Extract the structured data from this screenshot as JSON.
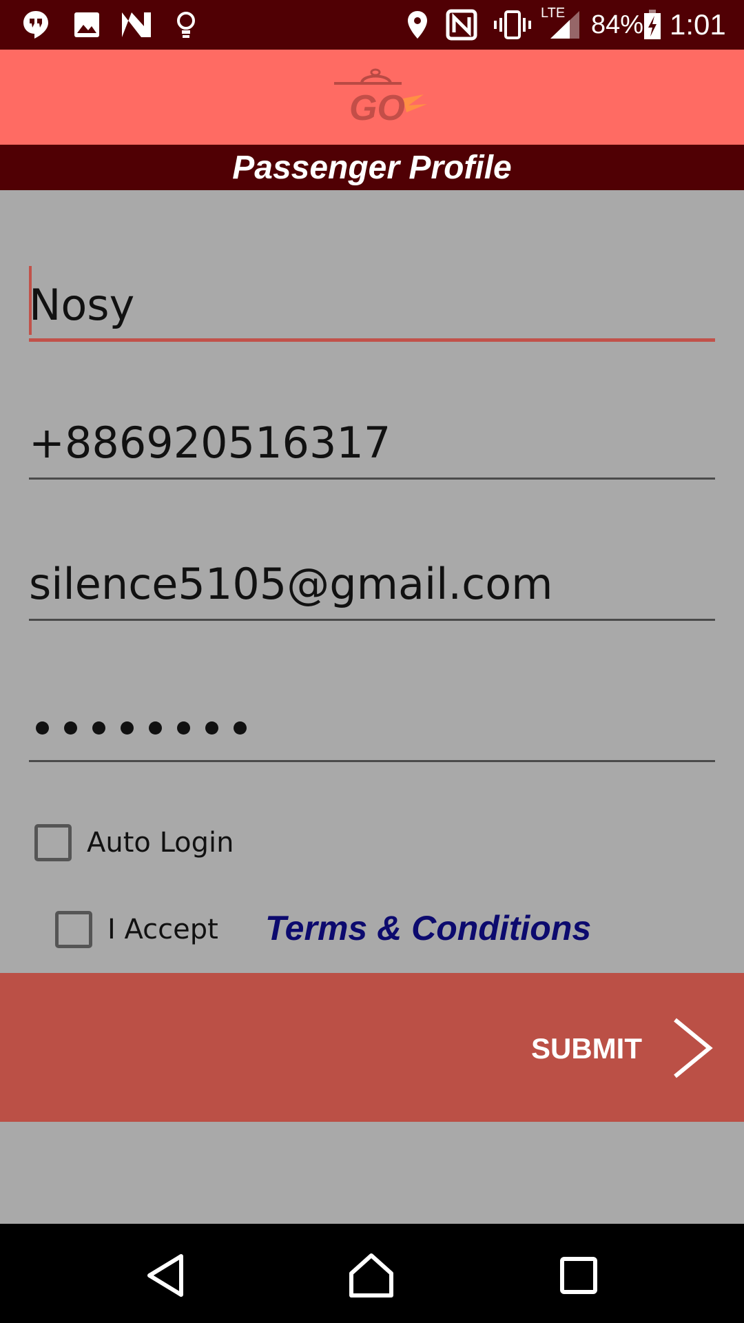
{
  "status_bar": {
    "icons": [
      "hangouts-icon",
      "image-icon",
      "n-logo-icon",
      "lightbulb-icon",
      "location-icon",
      "nfc-icon",
      "vibrate-icon",
      "signal-icon",
      "battery-icon"
    ],
    "network": "LTE",
    "battery": "84%",
    "time": "1:01"
  },
  "header": {
    "logo_text": "GO",
    "title": "Passenger Profile"
  },
  "form": {
    "name_value": "Nosy",
    "phone_value": "+886920516317",
    "email_value": "silence5105@gmail.com",
    "password_value": "••••••••",
    "auto_login_label": "Auto Login",
    "auto_login_checked": false,
    "accept_label": "I Accept",
    "accept_checked": false,
    "terms_link": "Terms & Conditions"
  },
  "submit": {
    "label": "SUBMIT"
  },
  "colors": {
    "status_bar": "#500004",
    "header": "#ff6b63",
    "background": "#a9a9a9",
    "submit": "#bb5046",
    "terms_link": "#0c0a6e"
  }
}
